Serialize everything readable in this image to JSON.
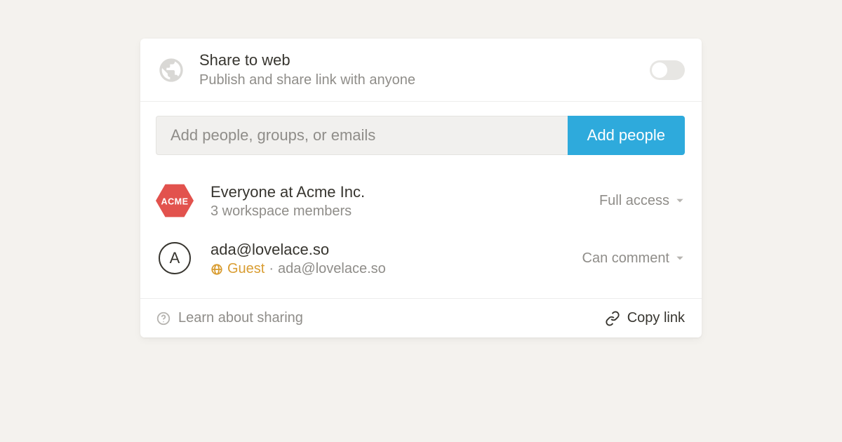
{
  "share_web": {
    "title": "Share to web",
    "subtitle": "Publish and share link with anyone",
    "enabled": false
  },
  "invite": {
    "placeholder": "Add people, groups, or emails",
    "button_label": "Add people"
  },
  "members": [
    {
      "name": "Everyone at Acme Inc.",
      "subtitle": "3 workspace members",
      "avatar_type": "acme",
      "avatar_text": "ACME",
      "access": "Full access"
    },
    {
      "name": "ada@lovelace.so",
      "avatar_type": "letter",
      "avatar_text": "A",
      "guest_label": "Guest",
      "email": "ada@lovelace.so",
      "access": "Can comment"
    }
  ],
  "footer": {
    "learn_label": "Learn about sharing",
    "copy_label": "Copy link"
  },
  "colors": {
    "accent": "#2eaadc",
    "guest": "#d99d32",
    "acme_red": "#e2524d"
  }
}
